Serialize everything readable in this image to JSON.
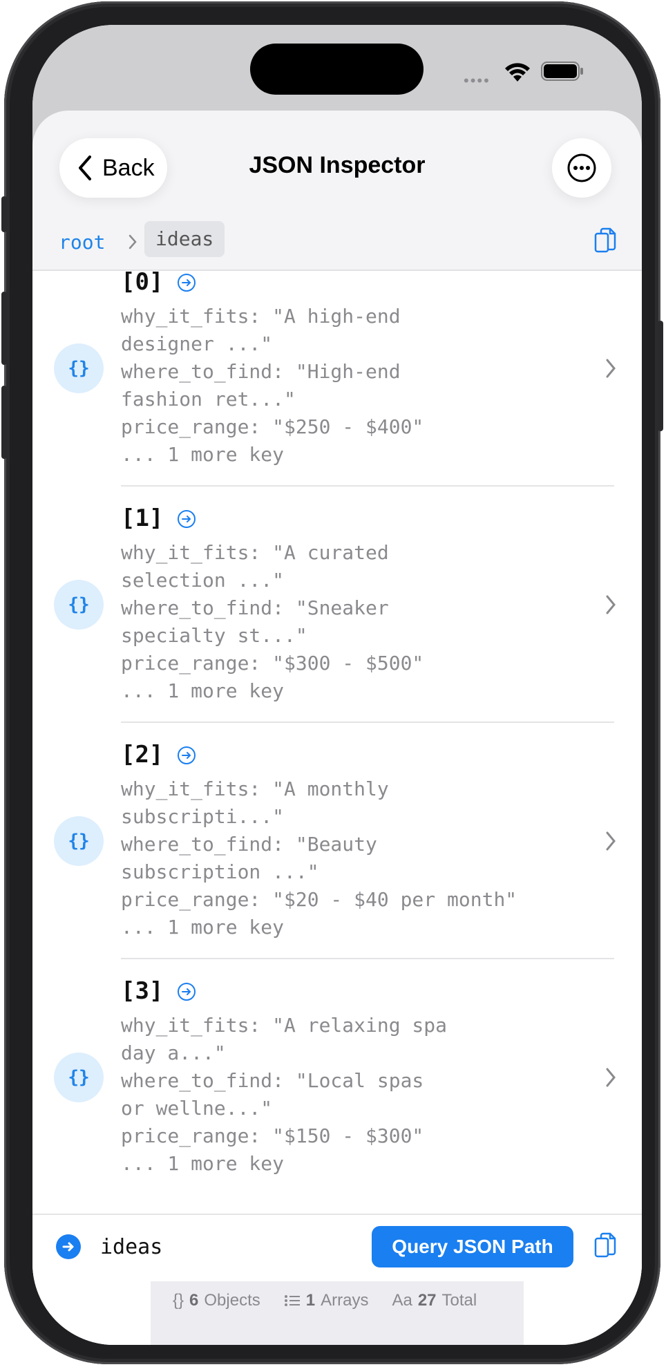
{
  "nav": {
    "back_label": "Back",
    "title": "JSON Inspector"
  },
  "breadcrumb": {
    "root": "root",
    "current": "ideas"
  },
  "items": [
    {
      "index": "[0]",
      "lines": "why_it_fits: \"A high-end\ndesigner ...\"\nwhere_to_find: \"High-end\nfashion ret...\"\nprice_range: \"$250 - $400\"\n... 1 more key",
      "icon": "{}"
    },
    {
      "index": "[1]",
      "lines": "why_it_fits: \"A curated\nselection ...\"\nwhere_to_find: \"Sneaker\nspecialty st...\"\nprice_range: \"$300 - $500\"\n... 1 more key",
      "icon": "{}"
    },
    {
      "index": "[2]",
      "lines": "why_it_fits: \"A monthly\nsubscripti...\"\nwhere_to_find: \"Beauty\nsubscription ...\"\nprice_range: \"$20 - $40 per month\"\n... 1 more key",
      "icon": "{}"
    },
    {
      "index": "[3]",
      "lines": "why_it_fits: \"A relaxing spa\nday a...\"\nwhere_to_find: \"Local spas\nor wellne...\"\nprice_range: \"$150 - $300\"\n... 1 more key",
      "icon": "{}"
    }
  ],
  "path_bar": {
    "value": "ideas",
    "query_label": "Query JSON Path"
  },
  "stats": {
    "objects_icon": "{}",
    "objects_count": "6",
    "objects_label": "Objects",
    "arrays_count": "1",
    "arrays_label": "Arrays",
    "total_icon": "Aa",
    "total_count": "27",
    "total_label": "Total"
  },
  "colors": {
    "accent": "#1a7ff0",
    "icon_bg": "#ddeefd",
    "text_muted": "#8a8a8e"
  },
  "icons": [
    "chevron-left-icon",
    "ellipsis-circle-icon",
    "copy-icon",
    "arrow-right-circle-icon",
    "chevron-right-icon",
    "list-icon",
    "wifi-icon",
    "battery-icon"
  ]
}
